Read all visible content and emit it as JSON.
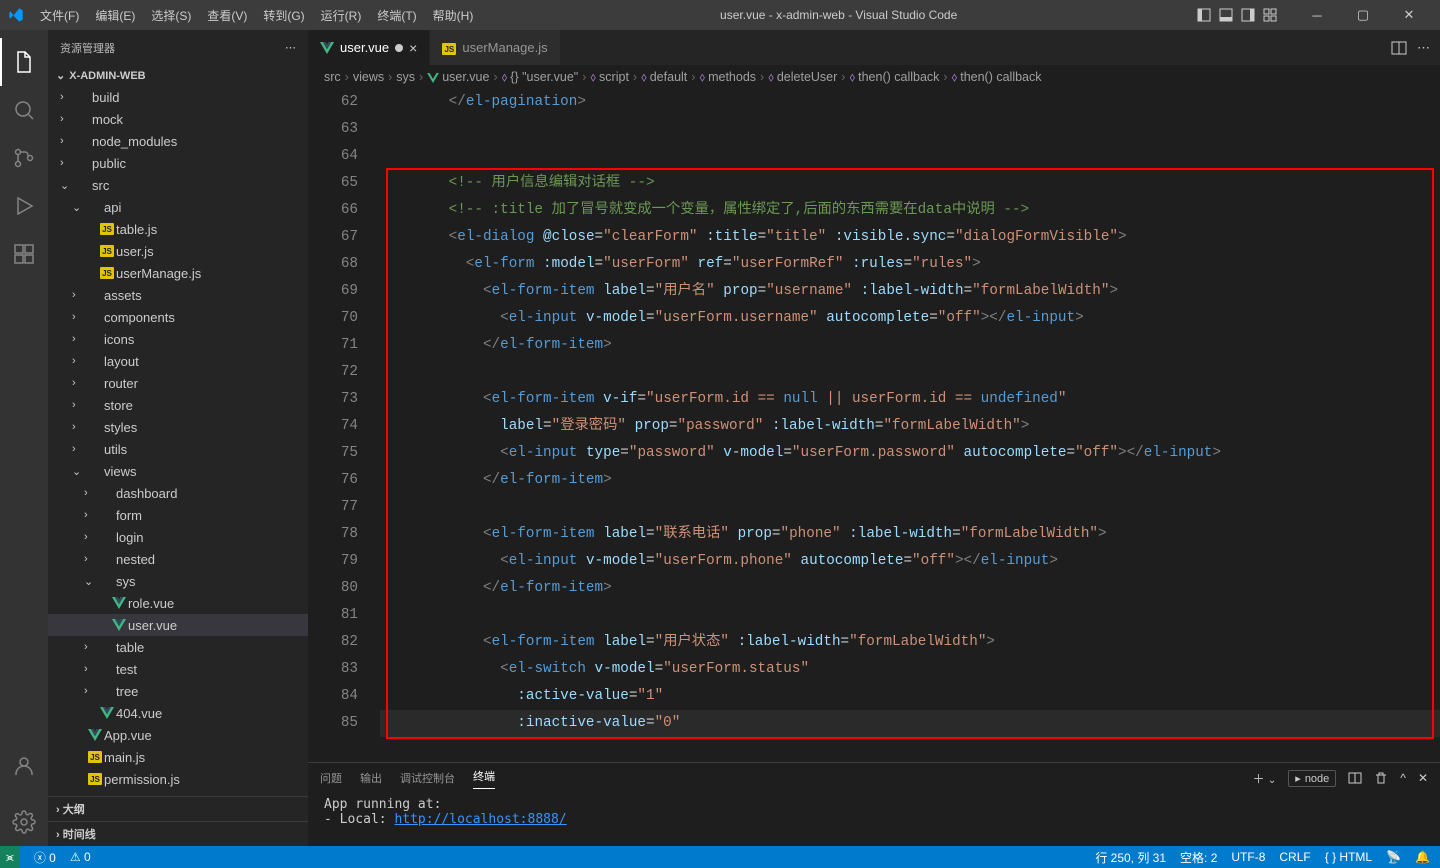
{
  "titlebar": {
    "menus": [
      "文件(F)",
      "编辑(E)",
      "选择(S)",
      "查看(V)",
      "转到(G)",
      "运行(R)",
      "终端(T)",
      "帮助(H)"
    ],
    "title": "user.vue - x-admin-web - Visual Studio Code"
  },
  "sidebar": {
    "title": "资源管理器",
    "project": "X-ADMIN-WEB",
    "tree": [
      {
        "indent": 0,
        "chev": "›",
        "label": "build",
        "kind": "folder"
      },
      {
        "indent": 0,
        "chev": "›",
        "label": "mock",
        "kind": "folder"
      },
      {
        "indent": 0,
        "chev": "›",
        "label": "node_modules",
        "kind": "folder"
      },
      {
        "indent": 0,
        "chev": "›",
        "label": "public",
        "kind": "folder"
      },
      {
        "indent": 0,
        "chev": "⌄",
        "label": "src",
        "kind": "folder"
      },
      {
        "indent": 1,
        "chev": "⌄",
        "label": "api",
        "kind": "folder"
      },
      {
        "indent": 2,
        "chev": "",
        "label": "table.js",
        "kind": "js"
      },
      {
        "indent": 2,
        "chev": "",
        "label": "user.js",
        "kind": "js"
      },
      {
        "indent": 2,
        "chev": "",
        "label": "userManage.js",
        "kind": "js"
      },
      {
        "indent": 1,
        "chev": "›",
        "label": "assets",
        "kind": "folder"
      },
      {
        "indent": 1,
        "chev": "›",
        "label": "components",
        "kind": "folder"
      },
      {
        "indent": 1,
        "chev": "›",
        "label": "icons",
        "kind": "folder"
      },
      {
        "indent": 1,
        "chev": "›",
        "label": "layout",
        "kind": "folder"
      },
      {
        "indent": 1,
        "chev": "›",
        "label": "router",
        "kind": "folder"
      },
      {
        "indent": 1,
        "chev": "›",
        "label": "store",
        "kind": "folder"
      },
      {
        "indent": 1,
        "chev": "›",
        "label": "styles",
        "kind": "folder"
      },
      {
        "indent": 1,
        "chev": "›",
        "label": "utils",
        "kind": "folder"
      },
      {
        "indent": 1,
        "chev": "⌄",
        "label": "views",
        "kind": "folder"
      },
      {
        "indent": 2,
        "chev": "›",
        "label": "dashboard",
        "kind": "folder"
      },
      {
        "indent": 2,
        "chev": "›",
        "label": "form",
        "kind": "folder"
      },
      {
        "indent": 2,
        "chev": "›",
        "label": "login",
        "kind": "folder"
      },
      {
        "indent": 2,
        "chev": "›",
        "label": "nested",
        "kind": "folder"
      },
      {
        "indent": 2,
        "chev": "⌄",
        "label": "sys",
        "kind": "folder"
      },
      {
        "indent": 3,
        "chev": "",
        "label": "role.vue",
        "kind": "vue"
      },
      {
        "indent": 3,
        "chev": "",
        "label": "user.vue",
        "kind": "vue",
        "selected": true
      },
      {
        "indent": 2,
        "chev": "›",
        "label": "table",
        "kind": "folder"
      },
      {
        "indent": 2,
        "chev": "›",
        "label": "test",
        "kind": "folder"
      },
      {
        "indent": 2,
        "chev": "›",
        "label": "tree",
        "kind": "folder"
      },
      {
        "indent": 2,
        "chev": "",
        "label": "404.vue",
        "kind": "vue"
      },
      {
        "indent": 1,
        "chev": "",
        "label": "App.vue",
        "kind": "vue"
      },
      {
        "indent": 1,
        "chev": "",
        "label": "main.js",
        "kind": "js"
      },
      {
        "indent": 1,
        "chev": "",
        "label": "permission.js",
        "kind": "js"
      }
    ],
    "footer": [
      "大纲",
      "时间线"
    ]
  },
  "tabs": [
    {
      "label": "user.vue",
      "kind": "vue",
      "active": true,
      "dirty": true
    },
    {
      "label": "userManage.js",
      "kind": "js",
      "active": false
    }
  ],
  "breadcrumbs": [
    "src",
    "views",
    "sys",
    "user.vue",
    "{} \"user.vue\"",
    "script",
    "default",
    "methods",
    "deleteUser",
    "then() callback",
    "then() callback"
  ],
  "line_start": 62,
  "code_lines": [
    {
      "n": 62,
      "html": "        <span class='t-pun'>&lt;/</span><span class='t-tag'>el-pagination</span><span class='t-pun'>&gt;</span>"
    },
    {
      "n": 63,
      "html": ""
    },
    {
      "n": 64,
      "html": ""
    },
    {
      "n": 65,
      "html": "        <span class='t-cmt'>&lt;!-- 用户信息编辑对话框 --&gt;</span>"
    },
    {
      "n": 66,
      "html": "        <span class='t-cmt'>&lt;!-- :title 加了冒号就变成一个变量，属性绑定了,后面的东西需要在data中说明 --&gt;</span>"
    },
    {
      "n": 67,
      "html": "        <span class='t-pun'>&lt;</span><span class='t-tag'>el-dialog</span> <span class='t-attr'>@close</span>=<span class='t-str'>\"clearForm\"</span> <span class='t-attr'>:title</span>=<span class='t-str'>\"title\"</span> <span class='t-attr'>:visible.sync</span>=<span class='t-str'>\"dialogFormVisible\"</span><span class='t-pun'>&gt;</span>"
    },
    {
      "n": 68,
      "html": "          <span class='t-pun'>&lt;</span><span class='t-tag'>el-form</span> <span class='t-attr'>:model</span>=<span class='t-str'>\"userForm\"</span> <span class='t-attr'>ref</span>=<span class='t-str'>\"userFormRef\"</span> <span class='t-attr'>:rules</span>=<span class='t-str'>\"rules\"</span><span class='t-pun'>&gt;</span>"
    },
    {
      "n": 69,
      "html": "            <span class='t-pun'>&lt;</span><span class='t-tag'>el-form-item</span> <span class='t-attr'>label</span>=<span class='t-str'>\"用户名\"</span> <span class='t-attr'>prop</span>=<span class='t-str'>\"username\"</span> <span class='t-attr'>:label-width</span>=<span class='t-str'>\"formLabelWidth\"</span><span class='t-pun'>&gt;</span>"
    },
    {
      "n": 70,
      "html": "              <span class='t-pun'>&lt;</span><span class='t-tag'>el-input</span> <span class='t-attr'>v-model</span>=<span class='t-str'>\"userForm.username\"</span> <span class='t-attr'>autocomplete</span>=<span class='t-str'>\"off\"</span><span class='t-pun'>&gt;&lt;/</span><span class='t-tag'>el-input</span><span class='t-pun'>&gt;</span>"
    },
    {
      "n": 71,
      "html": "            <span class='t-pun'>&lt;/</span><span class='t-tag'>el-form-item</span><span class='t-pun'>&gt;</span>"
    },
    {
      "n": 72,
      "html": ""
    },
    {
      "n": 73,
      "html": "            <span class='t-pun'>&lt;</span><span class='t-tag'>el-form-item</span> <span class='t-attr'>v-if</span>=<span class='t-str'>\"userForm.id == <span class='t-keywordv'>null</span> || userForm.id == <span class='t-keywordv'>undefined</span>\"</span>"
    },
    {
      "n": 74,
      "html": "              <span class='t-attr'>label</span>=<span class='t-str'>\"登录密码\"</span> <span class='t-attr'>prop</span>=<span class='t-str'>\"password\"</span> <span class='t-attr'>:label-width</span>=<span class='t-str'>\"formLabelWidth\"</span><span class='t-pun'>&gt;</span>"
    },
    {
      "n": 75,
      "html": "              <span class='t-pun'>&lt;</span><span class='t-tag'>el-input</span> <span class='t-attr'>type</span>=<span class='t-str'>\"password\"</span> <span class='t-attr'>v-model</span>=<span class='t-str'>\"userForm.password\"</span> <span class='t-attr'>autocomplete</span>=<span class='t-str'>\"off\"</span><span class='t-pun'>&gt;&lt;/</span><span class='t-tag'>el-input</span><span class='t-pun'>&gt;</span>"
    },
    {
      "n": 76,
      "html": "            <span class='t-pun'>&lt;/</span><span class='t-tag'>el-form-item</span><span class='t-pun'>&gt;</span>"
    },
    {
      "n": 77,
      "html": ""
    },
    {
      "n": 78,
      "html": "            <span class='t-pun'>&lt;</span><span class='t-tag'>el-form-item</span> <span class='t-attr'>label</span>=<span class='t-str'>\"联系电话\"</span> <span class='t-attr'>prop</span>=<span class='t-str'>\"phone\"</span> <span class='t-attr'>:label-width</span>=<span class='t-str'>\"formLabelWidth\"</span><span class='t-pun'>&gt;</span>"
    },
    {
      "n": 79,
      "html": "              <span class='t-pun'>&lt;</span><span class='t-tag'>el-input</span> <span class='t-attr'>v-model</span>=<span class='t-str'>\"userForm.phone\"</span> <span class='t-attr'>autocomplete</span>=<span class='t-str'>\"off\"</span><span class='t-pun'>&gt;&lt;/</span><span class='t-tag'>el-input</span><span class='t-pun'>&gt;</span>"
    },
    {
      "n": 80,
      "html": "            <span class='t-pun'>&lt;/</span><span class='t-tag'>el-form-item</span><span class='t-pun'>&gt;</span>"
    },
    {
      "n": 81,
      "html": ""
    },
    {
      "n": 82,
      "html": "            <span class='t-pun'>&lt;</span><span class='t-tag'>el-form-item</span> <span class='t-attr'>label</span>=<span class='t-str'>\"用户状态\"</span> <span class='t-attr'>:label-width</span>=<span class='t-str'>\"formLabelWidth\"</span><span class='t-pun'>&gt;</span>"
    },
    {
      "n": 83,
      "html": "              <span class='t-pun'>&lt;</span><span class='t-tag'>el-switch</span> <span class='t-attr'>v-model</span>=<span class='t-str'>\"userForm.status\"</span>"
    },
    {
      "n": 84,
      "html": "                <span class='t-attr'>:active-value</span>=<span class='t-str'>\"1\"</span>"
    },
    {
      "n": 85,
      "html": "                <span class='t-attr'>:inactive-value</span>=<span class='t-str'>\"0\"</span>",
      "current": true
    }
  ],
  "panel": {
    "tabs": [
      "问题",
      "输出",
      "调试控制台",
      "终端"
    ],
    "active": 3,
    "shell": "node",
    "body_line1": "App running at:",
    "body_line2_prefix": "- Local:   ",
    "body_line2_url": "http://localhost:8888/"
  },
  "statusbar": {
    "errors": "0",
    "warnings": "0",
    "cursor": "行 250, 列 31",
    "spaces": "空格: 2",
    "encoding": "UTF-8",
    "eol": "CRLF",
    "lang": "HTML"
  }
}
